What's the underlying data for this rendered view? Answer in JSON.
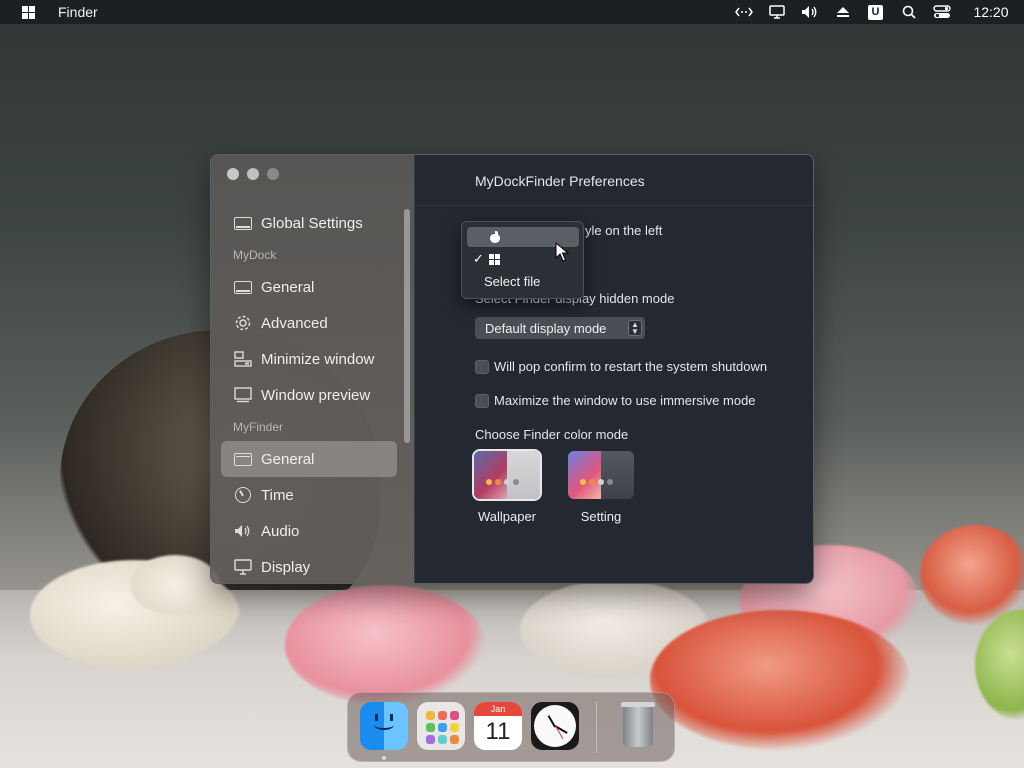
{
  "menubar": {
    "app_name": "Finder",
    "clock": "12:20",
    "tray_icons": [
      "remote-desktop-icon",
      "display-icon",
      "volume-icon",
      "eject-icon",
      "u-app-icon",
      "search-icon",
      "control-center-icon"
    ],
    "u_label": "U"
  },
  "window": {
    "title": "MyDockFinder Preferences",
    "sidebar": {
      "global_settings": "Global Settings",
      "section_mydock": "MyDock",
      "section_myfinder": "MyFinder",
      "mydock_items": [
        "General",
        "Advanced",
        "Minimize window",
        "Window preview"
      ],
      "myfinder_items": [
        "General",
        "Time",
        "Audio",
        "Display"
      ],
      "active_item": "MyFinder / General"
    },
    "main": {
      "style_label_partial": "yle on the left",
      "hidden_mode_label_partial": "Select Finder display hidden mode",
      "hidden_mode_value": "Default display mode",
      "checkbox_restart": "Will pop confirm to restart the system shutdown",
      "checkbox_immersive": "Maximize the window to use immersive mode",
      "color_mode_label": "Choose Finder color mode",
      "color_modes": [
        "Wallpaper",
        "Setting"
      ],
      "color_mode_selected": "Wallpaper"
    }
  },
  "popup": {
    "options": [
      "apple-icon",
      "windows-icon",
      "Select file"
    ],
    "select_file_label": "Select file",
    "checked": "windows-icon",
    "highlighted": "apple-icon",
    "checkmark": "✓"
  },
  "dock": {
    "apps": [
      "finder-icon",
      "launchpad-icon",
      "calendar-icon",
      "clock-icon",
      "trash-icon"
    ],
    "calendar_month": "Jan",
    "calendar_day": "11",
    "colors": {
      "launchpad": [
        "#f5b43a",
        "#f06a5a",
        "#e04a86",
        "#5ac35a",
        "#3aa0f0",
        "#f5d23a",
        "#a86ae0",
        "#5ad0d0",
        "#f08a3a"
      ]
    }
  }
}
